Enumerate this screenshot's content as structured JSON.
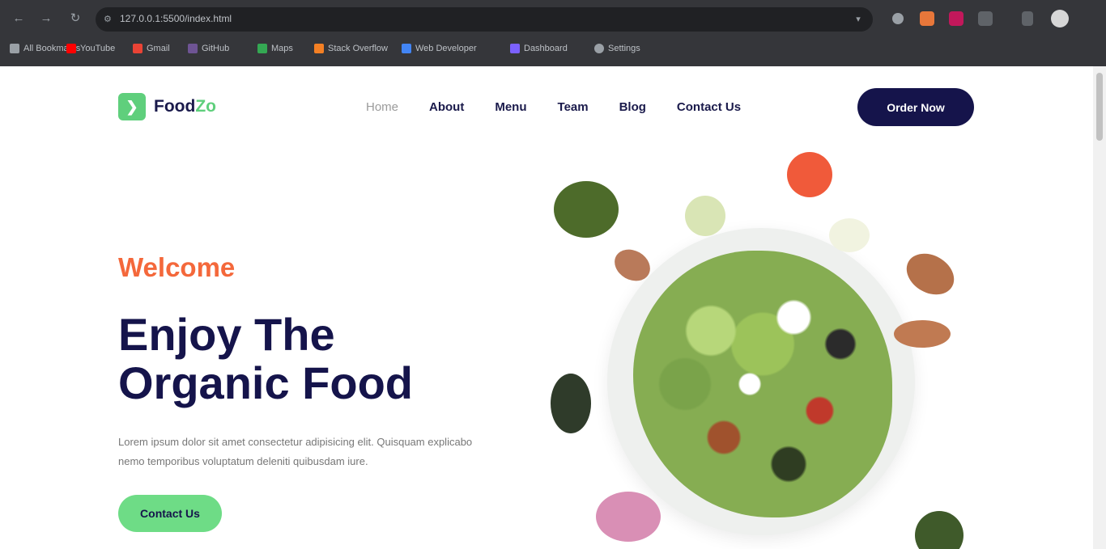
{
  "browser": {
    "url": "127.0.0.1:5500/index.html",
    "bookmarks": [
      {
        "label": "All Bookmarks",
        "color": "#9aa0a6"
      },
      {
        "label": "YouTube",
        "color": "#ff0000"
      },
      {
        "label": "Gmail",
        "color": "#ea4335"
      },
      {
        "label": "GitHub",
        "color": "#6e5494"
      },
      {
        "label": "Maps",
        "color": "#34a853"
      },
      {
        "label": "Stack Overflow",
        "color": "#f48024"
      },
      {
        "label": "Web Developer",
        "color": "#4285f4"
      },
      {
        "label": "Dashboard",
        "color": "#7b61ff"
      },
      {
        "label": "Settings",
        "color": "#9aa0a6"
      }
    ]
  },
  "site": {
    "logo_text": "Food",
    "logo_accent": "Zo",
    "nav": [
      "Home",
      "About",
      "Menu",
      "Team",
      "Blog",
      "Contact Us"
    ],
    "cta_top": "Order Now",
    "welcome": "Welcome",
    "headline_line1": "Enjoy The",
    "headline_line2": "Organic Food",
    "description": "Lorem ipsum dolor sit amet consectetur adipisicing elit. Quisquam explicabo nemo temporibus voluptatum deleniti quibusdam iure.",
    "cta_main": "Contact Us"
  },
  "colors": {
    "brand_navy": "#15144b",
    "accent_orange": "#f4683b",
    "accent_green": "#6edc86"
  }
}
